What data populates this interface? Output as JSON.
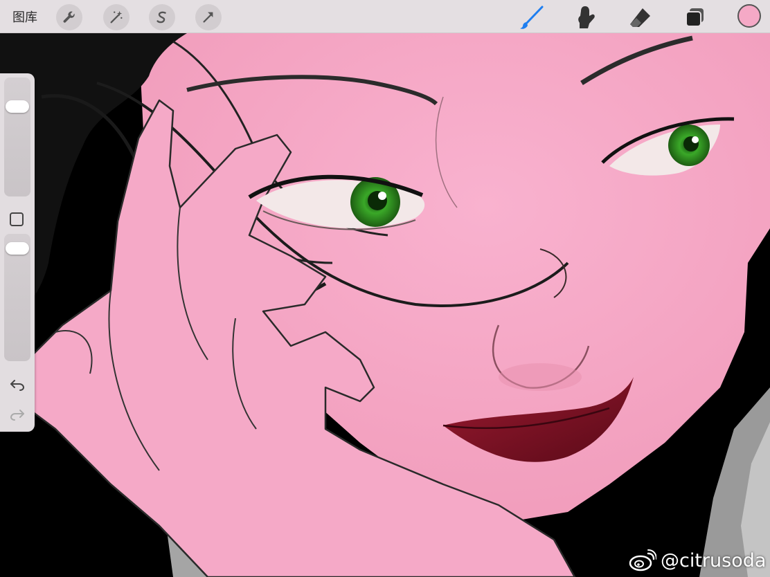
{
  "topbar": {
    "gallery_label": "图库",
    "actions": [
      {
        "icon": "wrench-icon"
      },
      {
        "icon": "magic-wand-icon"
      },
      {
        "icon": "selection-s-icon"
      },
      {
        "icon": "arrow-transform-icon"
      }
    ],
    "tools": [
      {
        "icon": "brush-icon",
        "active": true
      },
      {
        "icon": "smudge-icon",
        "active": false
      },
      {
        "icon": "eraser-icon",
        "active": false
      },
      {
        "icon": "layers-icon",
        "active": false
      }
    ],
    "current_color": "#f5a9c6"
  },
  "sidebar": {
    "brush_size_level": 0.2,
    "opacity_level": 0.05
  },
  "watermark": {
    "text": "@citrusoda",
    "icon": "weibo-icon"
  },
  "colors": {
    "skin": "#f7aac8",
    "accent_blue": "#1e7ef0",
    "hair": "#111111",
    "eye": "#3aa828",
    "lips": "#7c1020"
  }
}
